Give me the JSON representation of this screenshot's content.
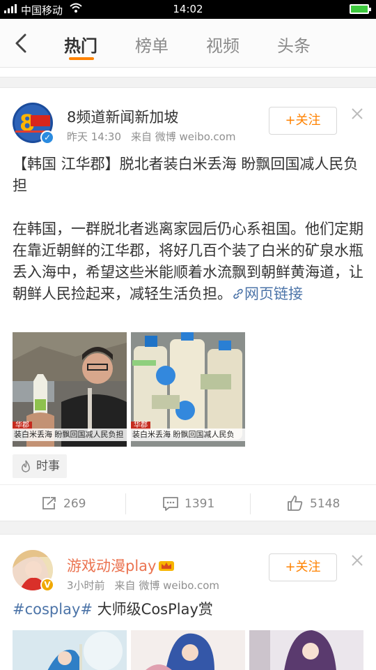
{
  "status_bar": {
    "carrier": "中国移动",
    "time": "14:02"
  },
  "nav": {
    "tabs": [
      {
        "label": "热门",
        "active": true
      },
      {
        "label": "榜单",
        "active": false
      },
      {
        "label": "视频",
        "active": false
      },
      {
        "label": "头条",
        "active": false
      }
    ],
    "accent_color": "#ff8200"
  },
  "posts": [
    {
      "user": "8频道新闻新加坡",
      "time": "昨天 14:30",
      "source": "来自 微博 weibo.com",
      "follow_label": "+关注",
      "headline": "【韩国 江华郡】脱北者装白米丢海 盼飘回国减人民负担",
      "body": "在韩国，一群脱北者逃离家园后仍心系祖国。他们定期在靠近朝鲜的江华郡，将好几百个装了白米的矿泉水瓶丢入海中，希望这些米能顺着水流飘到朝鲜黄海道，让朝鲜人民捡起来，减轻生活负担。",
      "link_label": "网页链接",
      "images": [
        {
          "tag": "华郡",
          "caption": "装白米丢海 盼飘回国减人民负担"
        },
        {
          "tag": "华郡",
          "caption": "装白米丢海 盼飘回国减人民负"
        }
      ],
      "topic_tag": "时事",
      "reposts": "269",
      "comments": "1391",
      "likes": "5148"
    },
    {
      "user": "游戏动漫play",
      "time": "3小时前",
      "source": "来自 微博 weibo.com",
      "follow_label": "+关注",
      "text_topic": "#cosplay#",
      "text_rest": " 大师级CosPlay赏"
    }
  ]
}
